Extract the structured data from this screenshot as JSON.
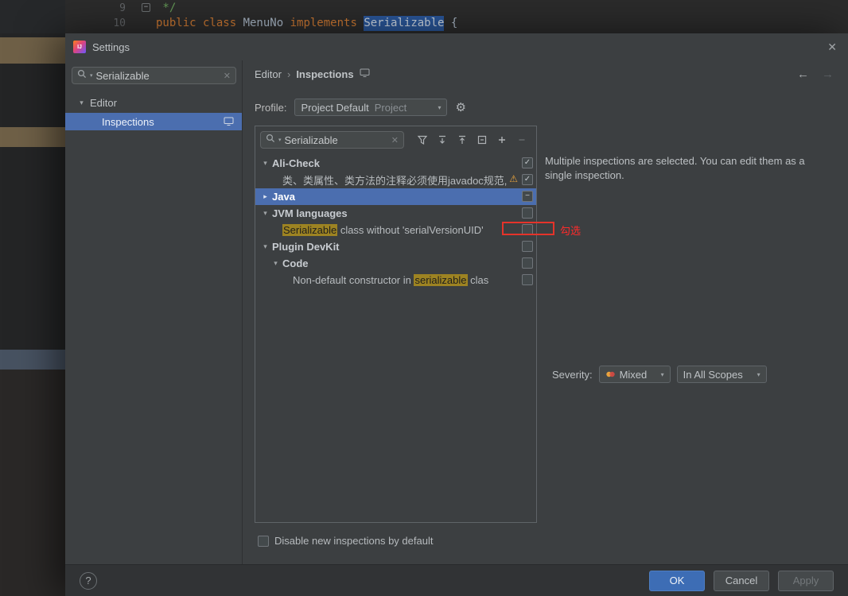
{
  "colors": {
    "accent_blue": "#4b6eaf",
    "editor_selection": "#2a5699",
    "match_highlight": "#9d8322",
    "annotation_red": "#ff2b2b",
    "keyword_orange": "#cc7832",
    "ok_button_blue": "#3d6db5"
  },
  "editor": {
    "lines": [
      {
        "number": "9",
        "fold": true,
        "tokens": [
          {
            "t": " */",
            "c": "comment"
          }
        ]
      },
      {
        "number": "10",
        "fold": false,
        "tokens": [
          {
            "t": "public class ",
            "c": "keyword"
          },
          {
            "t": "MenuNo ",
            "c": "plain"
          },
          {
            "t": "implements ",
            "c": "keyword"
          },
          {
            "t": "Serializable",
            "c": "selected"
          },
          {
            "t": " {",
            "c": "plain"
          }
        ]
      }
    ]
  },
  "dialog": {
    "title": "Settings",
    "sidebar": {
      "search": {
        "value": "Serializable"
      },
      "items": [
        {
          "label": "Editor"
        },
        {
          "label": "Inspections"
        }
      ]
    },
    "breadcrumb": {
      "part1": "Editor",
      "separator": "›",
      "part2": "Inspections"
    },
    "profile": {
      "label": "Profile:",
      "value": "Project Default",
      "hint": "Project"
    },
    "inspections": {
      "search": {
        "value": "Serializable"
      },
      "rows": [
        {
          "indent": 0,
          "chevron": "down",
          "label": "Ali-Check",
          "bold": true,
          "check": "checked"
        },
        {
          "indent": 1,
          "chevron": "none",
          "label": "类、类属性、类方法的注释必须使用javadoc规范,",
          "check": "checked",
          "warning": true
        },
        {
          "indent": 0,
          "chevron": "right",
          "label": "Java",
          "bold": true,
          "check": "partial",
          "selected": true
        },
        {
          "indent": 0,
          "chevron": "down",
          "label": "JVM languages",
          "bold": true,
          "check": "unchecked"
        },
        {
          "indent": 1,
          "chevron": "none",
          "parts": [
            {
              "t": "Serializable",
              "hl": true
            },
            {
              "t": " class without 'serialVersionUID'"
            }
          ],
          "check": "unchecked",
          "red_box": true
        },
        {
          "indent": 0,
          "chevron": "down",
          "label": "Plugin DevKit",
          "bold": true,
          "check": "unchecked"
        },
        {
          "indent": 1,
          "chevron": "down",
          "label": "Code",
          "bold": true,
          "check": "unchecked"
        },
        {
          "indent": 2,
          "chevron": "none",
          "parts": [
            {
              "t": "Non-default constructor in "
            },
            {
              "t": "serializable",
              "hl": true
            },
            {
              "t": " clas"
            }
          ],
          "check": "unchecked"
        }
      ],
      "annotation": {
        "text": "勾选"
      }
    },
    "detail": {
      "message": "Multiple inspections are selected. You can edit them as a single inspection.",
      "severity_label": "Severity:",
      "severity_value": "Mixed",
      "scope_value": "In All Scopes"
    },
    "footer": {
      "disable_label": "Disable new inspections by default"
    },
    "buttons": {
      "ok": "OK",
      "cancel": "Cancel",
      "apply": "Apply"
    }
  }
}
